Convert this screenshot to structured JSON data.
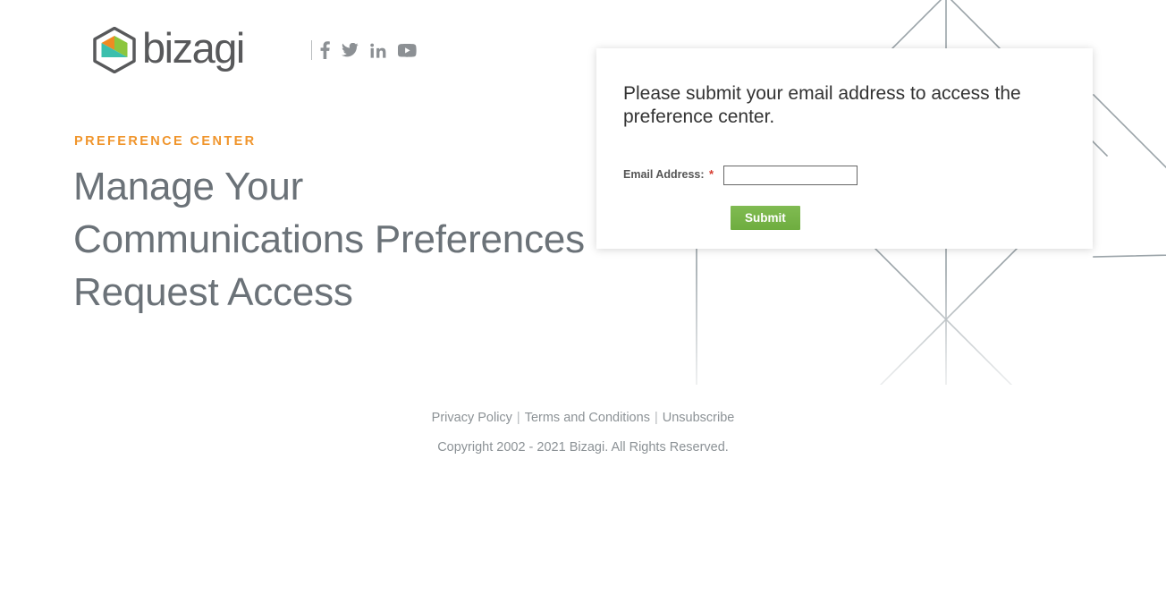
{
  "brand": {
    "name": "bizagi",
    "logo_icon": "bizagi-hexagon-logo",
    "wordmark_color": "#58595B",
    "hex_colors": {
      "orange": "#EF8B22",
      "green": "#8CC63E",
      "teal": "#3BBFAD",
      "outline": "#58595B"
    }
  },
  "social": [
    {
      "name": "facebook-icon",
      "label": "Facebook"
    },
    {
      "name": "twitter-icon",
      "label": "Twitter"
    },
    {
      "name": "linkedin-icon",
      "label": "LinkedIn"
    },
    {
      "name": "youtube-icon",
      "label": "YouTube"
    }
  ],
  "hero": {
    "eyebrow": "PREFERENCE CENTER",
    "eyebrow_color": "#F0952C",
    "title_line1": "Manage Your",
    "title_line2": "Communications Preferences",
    "title_line3": "Request Access",
    "title_color": "#6B7278"
  },
  "form": {
    "heading": "Please submit your email address to access the preference center.",
    "email_label": "Email Address:",
    "required_marker": "*",
    "required_color": "#D63B2F",
    "email_value": "",
    "email_placeholder": "",
    "submit_label": "Submit",
    "submit_color": "#76B548"
  },
  "footer": {
    "links": [
      {
        "label": "Privacy Policy"
      },
      {
        "label": "Terms and Conditions"
      },
      {
        "label": "Unsubscribe"
      }
    ],
    "separator": "|",
    "copyright": "Copyright 2002 - 2021 Bizagi. All Rights Reserved."
  },
  "background": {
    "pattern_name": "geometric-line-pattern",
    "line_color": "#9AA3A8"
  }
}
